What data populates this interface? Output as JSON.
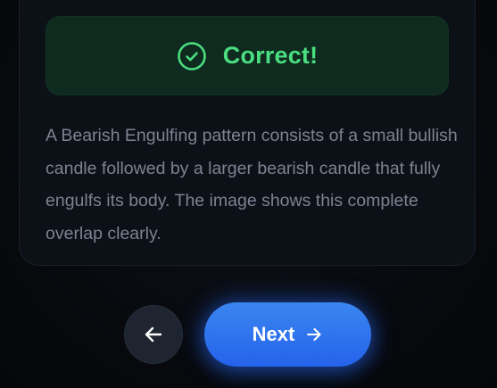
{
  "feedback": {
    "status_label": "Correct!",
    "status_icon": "check-circle-icon",
    "accent_color": "#4ade80"
  },
  "explanation": {
    "text": "A Bearish Engulfing pattern consists of a small bullish candle followed by a larger bearish candle that fully engulfs its body. The image shows this complete overlap clearly."
  },
  "navigation": {
    "back_icon": "arrow-left-icon",
    "next_label": "Next",
    "next_icon": "arrow-right-icon",
    "primary_color": "#2563eb"
  }
}
